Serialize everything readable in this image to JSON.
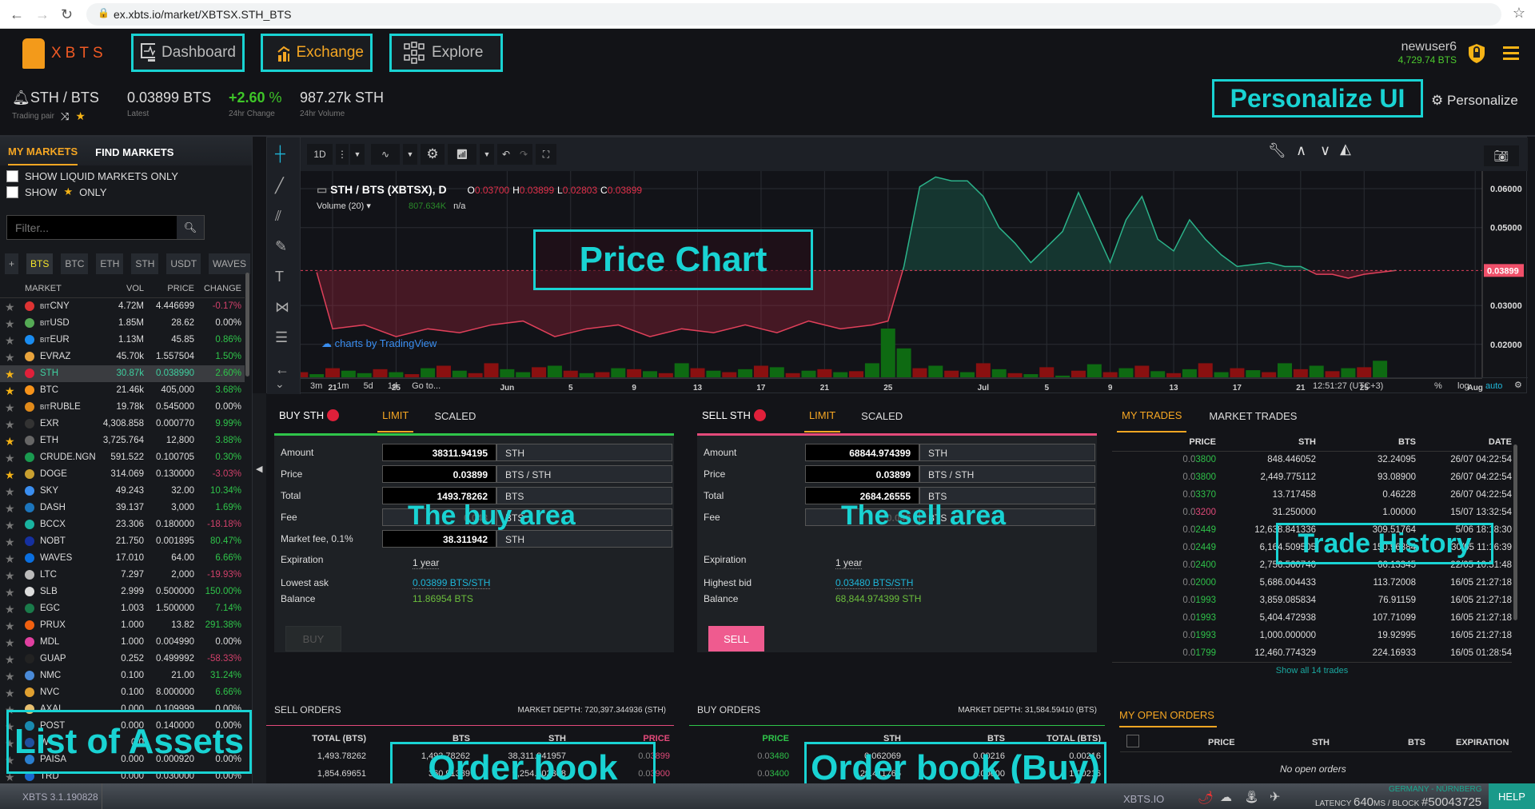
{
  "browser": {
    "url": "ex.xbts.io/market/XBTSX.STH_BTS"
  },
  "nav": {
    "logo": "XBTS",
    "items": [
      {
        "label": "Dashboard"
      },
      {
        "label": "Exchange"
      },
      {
        "label": "Explore"
      }
    ],
    "user": "newuser6",
    "balance": "4,729.74 BTS"
  },
  "market_info": {
    "pair": "STH / BTS",
    "pair_label": "Trading pair",
    "latest": "0.03899 BTS",
    "latest_label": "Latest",
    "change": "+2.60",
    "change_unit": " %",
    "change_label": "24hr Change",
    "volume": "987.27k STH",
    "volume_label": "24hr Volume",
    "personalize": "Personalize"
  },
  "annotations": {
    "personalize": "Personalize UI",
    "price_chart": "Price Chart",
    "buy_area": "The buy area",
    "sell_area": "The sell area",
    "trade_history": "Trade History",
    "assets": "List of Assets",
    "order_book": "Order book",
    "order_book_buy": "Order book (Buy)"
  },
  "left": {
    "tabs": [
      "MY MARKETS",
      "FIND MARKETS"
    ],
    "liquid": "SHOW LIQUID MARKETS ONLY",
    "show": "SHOW",
    "only": "ONLY",
    "filter_placeholder": "Filter...",
    "quotes": [
      "+",
      "BTS",
      "BTC",
      "ETH",
      "STH",
      "USDT",
      "WAVES"
    ],
    "headers": [
      "MARKET",
      "VOL",
      "PRICE",
      "CHANGE"
    ],
    "markets": [
      {
        "name": "CNY",
        "bit": true,
        "vol": "4.72M",
        "price": "4.446699",
        "change": "-0.17%",
        "star": false,
        "c": "#d33"
      },
      {
        "name": "USD",
        "bit": true,
        "vol": "1.85M",
        "price": "28.62",
        "change": "0.00%",
        "star": false,
        "c": "#5a5"
      },
      {
        "name": "EUR",
        "bit": true,
        "vol": "1.13M",
        "price": "45.85",
        "change": "0.86%",
        "star": false,
        "c": "#1a8cf0"
      },
      {
        "name": "EVRAZ",
        "vol": "45.70k",
        "price": "1.557504",
        "change": "1.50%",
        "star": false,
        "c": "#e8a33c"
      },
      {
        "name": "STH",
        "vol": "30.87k",
        "price": "0.038990",
        "change": "2.60%",
        "star": true,
        "sel": true,
        "c": "#e0203a"
      },
      {
        "name": "BTC",
        "vol": "21.46k",
        "price": "405,000",
        "change": "3.68%",
        "star": true,
        "c": "#f7931a"
      },
      {
        "name": "RUBLE",
        "bit": true,
        "vol": "19.78k",
        "price": "0.545000",
        "change": "0.00%",
        "star": false,
        "c": "#e08a1a"
      },
      {
        "name": "EXR",
        "vol": "4,308.858",
        "price": "0.000770",
        "change": "9.99%",
        "star": false,
        "c": "#333"
      },
      {
        "name": "ETH",
        "vol": "3,725.764",
        "price": "12,800",
        "change": "3.88%",
        "star": true,
        "c": "#666"
      },
      {
        "name": "CRUDE.NGN",
        "vol": "591.522",
        "price": "0.100705",
        "change": "0.30%",
        "star": false,
        "c": "#1a9a50"
      },
      {
        "name": "DOGE",
        "vol": "314.069",
        "price": "0.130000",
        "change": "-3.03%",
        "star": true,
        "c": "#c9a030"
      },
      {
        "name": "SKY",
        "vol": "49.243",
        "price": "32.00",
        "change": "10.34%",
        "star": false,
        "c": "#3a8ef0"
      },
      {
        "name": "DASH",
        "vol": "39.137",
        "price": "3,000",
        "change": "1.69%",
        "star": false,
        "c": "#1c75bc"
      },
      {
        "name": "BCCX",
        "vol": "23.306",
        "price": "0.180000",
        "change": "-18.18%",
        "star": false,
        "c": "#19b3a0"
      },
      {
        "name": "NOBT",
        "vol": "21.750",
        "price": "0.001895",
        "change": "80.47%",
        "star": false,
        "c": "#1530a0"
      },
      {
        "name": "WAVES",
        "vol": "17.010",
        "price": "64.00",
        "change": "6.66%",
        "star": false,
        "c": "#0a6fe0"
      },
      {
        "name": "LTC",
        "vol": "7.297",
        "price": "2,000",
        "change": "-19.93%",
        "star": false,
        "c": "#bbb"
      },
      {
        "name": "SLB",
        "vol": "2.999",
        "price": "0.500000",
        "change": "150.00%",
        "star": false,
        "c": "#ddd"
      },
      {
        "name": "EGC",
        "vol": "1.003",
        "price": "1.500000",
        "change": "7.14%",
        "star": false,
        "c": "#1a7a4a"
      },
      {
        "name": "PRUX",
        "vol": "1.000",
        "price": "13.82",
        "change": "291.38%",
        "star": false,
        "c": "#f06010"
      },
      {
        "name": "MDL",
        "vol": "1.000",
        "price": "0.004990",
        "change": "0.00%",
        "star": false,
        "c": "#e040a0"
      },
      {
        "name": "GUAP",
        "vol": "0.252",
        "price": "0.499992",
        "change": "-58.33%",
        "star": false,
        "c": "#222"
      },
      {
        "name": "NMC",
        "vol": "0.100",
        "price": "21.00",
        "change": "31.24%",
        "star": false,
        "c": "#4a8ad8"
      },
      {
        "name": "NVC",
        "vol": "0.100",
        "price": "8.000000",
        "change": "6.66%",
        "star": false,
        "c": "#e0a030"
      },
      {
        "name": "AXAI",
        "vol": "0.000",
        "price": "0.109999",
        "change": "0.00%",
        "star": false,
        "c": "#e8c070"
      },
      {
        "name": "POST",
        "vol": "0.000",
        "price": "0.140000",
        "change": "0.00%",
        "star": false,
        "c": "#1a8ab0"
      },
      {
        "name": "W",
        "vol": "0.0",
        "price": "",
        "change": "",
        "star": false,
        "c": "#2050a0"
      },
      {
        "name": "PAISA",
        "vol": "0.000",
        "price": "0.000920",
        "change": "0.00%",
        "star": false,
        "c": "#2a80d0"
      },
      {
        "name": "TRD",
        "vol": "0.000",
        "price": "0.030000",
        "change": "0.00%",
        "star": false,
        "c": "#1a6ad0"
      }
    ]
  },
  "chart": {
    "interval": "1D",
    "legend_title": "STH / BTS (XBTSX), D",
    "o": "0.03700",
    "h": "0.03899",
    "l": "0.02803",
    "c": "0.03899",
    "volume_label": "Volume (20)",
    "volume_value": "807.634K",
    "volume_na": "n/a",
    "watermark": "charts by TradingView",
    "y_ticks": [
      "0.06000",
      "0.05000",
      "0.03000",
      "0.02000"
    ],
    "y_tick_values": [
      0.06,
      0.05,
      0.03,
      0.02
    ],
    "last_price": "0.03899",
    "last_value": 0.03899,
    "x_ticks": [
      {
        "label": "21",
        "day": 2
      },
      {
        "label": "25",
        "day": 6
      },
      {
        "label": "Jun",
        "day": 13
      },
      {
        "label": "5",
        "day": 17
      },
      {
        "label": "9",
        "day": 21
      },
      {
        "label": "13",
        "day": 25
      },
      {
        "label": "17",
        "day": 29
      },
      {
        "label": "21",
        "day": 33
      },
      {
        "label": "25",
        "day": 37
      },
      {
        "label": "Jul",
        "day": 43
      },
      {
        "label": "5",
        "day": 47
      },
      {
        "label": "9",
        "day": 51
      },
      {
        "label": "13",
        "day": 55
      },
      {
        "label": "17",
        "day": 59
      },
      {
        "label": "21",
        "day": 63
      },
      {
        "label": "25",
        "day": 67
      },
      {
        "label": "Aug",
        "day": 74
      }
    ],
    "ranges": [
      "3m",
      "1m",
      "5d",
      "1d",
      "Go to..."
    ],
    "time": "12:51:27 (UTC+3)",
    "pct": "%",
    "log": "log",
    "auto": "auto",
    "close": [
      [
        1,
        0.0385
      ],
      [
        2,
        0.024
      ],
      [
        4,
        0.025
      ],
      [
        6,
        0.022
      ],
      [
        8,
        0.024
      ],
      [
        10,
        0.023
      ],
      [
        12,
        0.025
      ],
      [
        14,
        0.026
      ],
      [
        16,
        0.022
      ],
      [
        18,
        0.024
      ],
      [
        20,
        0.025
      ],
      [
        22,
        0.022
      ],
      [
        24,
        0.024
      ],
      [
        26,
        0.023
      ],
      [
        28,
        0.025
      ],
      [
        30,
        0.023
      ],
      [
        32,
        0.026
      ],
      [
        34,
        0.024
      ],
      [
        36,
        0.025
      ],
      [
        37,
        0.026
      ],
      [
        38,
        0.04
      ],
      [
        39,
        0.0605
      ],
      [
        40,
        0.063
      ],
      [
        41,
        0.062
      ],
      [
        42,
        0.062
      ],
      [
        43,
        0.058
      ],
      [
        44,
        0.05
      ],
      [
        45,
        0.046
      ],
      [
        46,
        0.041
      ],
      [
        47,
        0.045
      ],
      [
        48,
        0.049
      ],
      [
        49,
        0.059
      ],
      [
        50,
        0.05
      ],
      [
        51,
        0.041
      ],
      [
        52,
        0.052
      ],
      [
        53,
        0.058
      ],
      [
        54,
        0.047
      ],
      [
        55,
        0.044
      ],
      [
        56,
        0.052
      ],
      [
        57,
        0.047
      ],
      [
        58,
        0.043
      ],
      [
        59,
        0.04
      ],
      [
        61,
        0.041
      ],
      [
        62,
        0.04
      ],
      [
        63,
        0.04
      ],
      [
        64,
        0.038
      ],
      [
        65,
        0.038
      ],
      [
        66,
        0.037
      ],
      [
        67,
        0.038
      ],
      [
        69,
        0.039
      ]
    ],
    "volume": [
      -12,
      8,
      -20,
      15,
      10,
      -18,
      12,
      -8,
      20,
      -25,
      15,
      -10,
      -30,
      18,
      12,
      -22,
      25,
      -15,
      10,
      -12,
      20,
      -18,
      14,
      -10,
      30,
      -20,
      15,
      -12,
      18,
      -25,
      22,
      -10,
      15,
      -18,
      12,
      -14,
      30,
      100,
      60,
      -20,
      25,
      -15,
      12,
      -30,
      18,
      -10,
      8,
      -22,
      5,
      -15,
      28,
      -12,
      20,
      -25,
      14,
      -10,
      18,
      -30,
      12,
      -20,
      16,
      -12,
      30,
      -18,
      25,
      -14,
      20,
      -22,
      35
    ]
  },
  "buy": {
    "title": "BUY STH",
    "tabs": [
      "LIMIT",
      "SCALED"
    ],
    "amount_label": "Amount",
    "amount": "38311.94195",
    "amount_unit": "STH",
    "price_label": "Price",
    "price": "0.03899",
    "price_unit": "BTS / STH",
    "total_label": "Total",
    "total": "1493.78262",
    "total_unit": "BTS",
    "fee_label": "Fee",
    "fee": "0.048",
    "fee_unit": "BTS",
    "mfee_label": "Market fee, 0.1%",
    "mfee": "38.311942",
    "mfee_unit": "STH",
    "exp_label": "Expiration",
    "exp": "1 year",
    "ask_label": "Lowest ask",
    "ask": "0.03899 BTS/STH",
    "bal_label": "Balance",
    "bal": "11.86954 BTS",
    "button": "BUY"
  },
  "sell": {
    "title": "SELL STH",
    "tabs": [
      "LIMIT",
      "SCALED"
    ],
    "amount_label": "Amount",
    "amount": "68844.974399",
    "amount_unit": "STH",
    "price_label": "Price",
    "price": "0.03899",
    "price_unit": "BTS / STH",
    "total_label": "Total",
    "total": "2684.26555",
    "total_unit": "BTS",
    "fee_label": "Fee",
    "fee": "0.048",
    "fee_unit": "BTS",
    "exp_label": "Expiration",
    "exp": "1 year",
    "bid_label": "Highest bid",
    "bid": "0.03480 BTS/STH",
    "bal_label": "Balance",
    "bal": "68,844.974399 STH",
    "button": "SELL"
  },
  "trades": {
    "tabs": [
      "MY TRADES",
      "MARKET TRADES"
    ],
    "headers": [
      "PRICE",
      "STH",
      "BTS",
      "DATE"
    ],
    "rows": [
      [
        "0.03800",
        "848.446052",
        "32.24095",
        "26/07 04:22:54",
        "g"
      ],
      [
        "0.03800",
        "2,449.775112",
        "93.08900",
        "26/07 04:22:54",
        "g"
      ],
      [
        "0.03370",
        "13.717458",
        "0.46228",
        "26/07 04:22:54",
        "g"
      ],
      [
        "0.03200",
        "31.250000",
        "1.00000",
        "15/07 13:32:54",
        "r"
      ],
      [
        "0.02449",
        "12,638.841336",
        "309.51764",
        "5/06 18:18:30",
        "g"
      ],
      [
        "0.02449",
        "6,164.509505",
        "150.96884",
        "30/05 11:16:39",
        "g"
      ],
      [
        "0.02400",
        "2,756.560740",
        "66.13345",
        "22/05 10:51:48",
        "g"
      ],
      [
        "0.02000",
        "5,686.004433",
        "113.72008",
        "16/05 21:27:18",
        "g"
      ],
      [
        "0.01993",
        "3,859.085834",
        "76.91159",
        "16/05 21:27:18",
        "g"
      ],
      [
        "0.01993",
        "5,404.472938",
        "107.71099",
        "16/05 21:27:18",
        "g"
      ],
      [
        "0.01993",
        "1,000.000000",
        "19.92995",
        "16/05 21:27:18",
        "g"
      ],
      [
        "0.01799",
        "12,460.774329",
        "224.16933",
        "16/05 01:28:54",
        "g"
      ]
    ],
    "show_all": "Show all 14 trades"
  },
  "sell_orders": {
    "title": "SELL ORDERS",
    "depth": "MARKET DEPTH: 720,397.344936 (STH)",
    "headers": [
      "TOTAL (BTS)",
      "BTS",
      "STH",
      "PRICE"
    ],
    "rows": [
      [
        "1,493.78262",
        "1,493.78262",
        "38,311.941957",
        "0.03899"
      ],
      [
        "1,854.69651",
        "360.91389",
        "9,254.202308",
        "0.03900"
      ]
    ]
  },
  "buy_orders": {
    "title": "BUY ORDERS",
    "depth": "MARKET DEPTH: 31,584.59410 (BTS)",
    "headers": [
      "PRICE",
      "STH",
      "BTS",
      "TOTAL (BTS)"
    ],
    "rows": [
      [
        "0.03480",
        "0.062069",
        "0.00216",
        "0.00216"
      ],
      [
        "0.03400",
        "29.411765",
        "1.00000",
        "1.00216"
      ]
    ]
  },
  "open_orders": {
    "title": "MY OPEN ORDERS",
    "headers": [
      "PRICE",
      "STH",
      "BTS",
      "EXPIRATION"
    ],
    "empty": "No open orders"
  },
  "footer": {
    "version": "XBTS 3.1.190828",
    "site": "XBTS.IO",
    "location": "GERMANY - NÜRNBERG",
    "latency_label": "LATENCY",
    "latency": "640",
    "latency_unit": "MS",
    "block_label": "BLOCK",
    "block": "#50043725",
    "help": "HELP"
  }
}
